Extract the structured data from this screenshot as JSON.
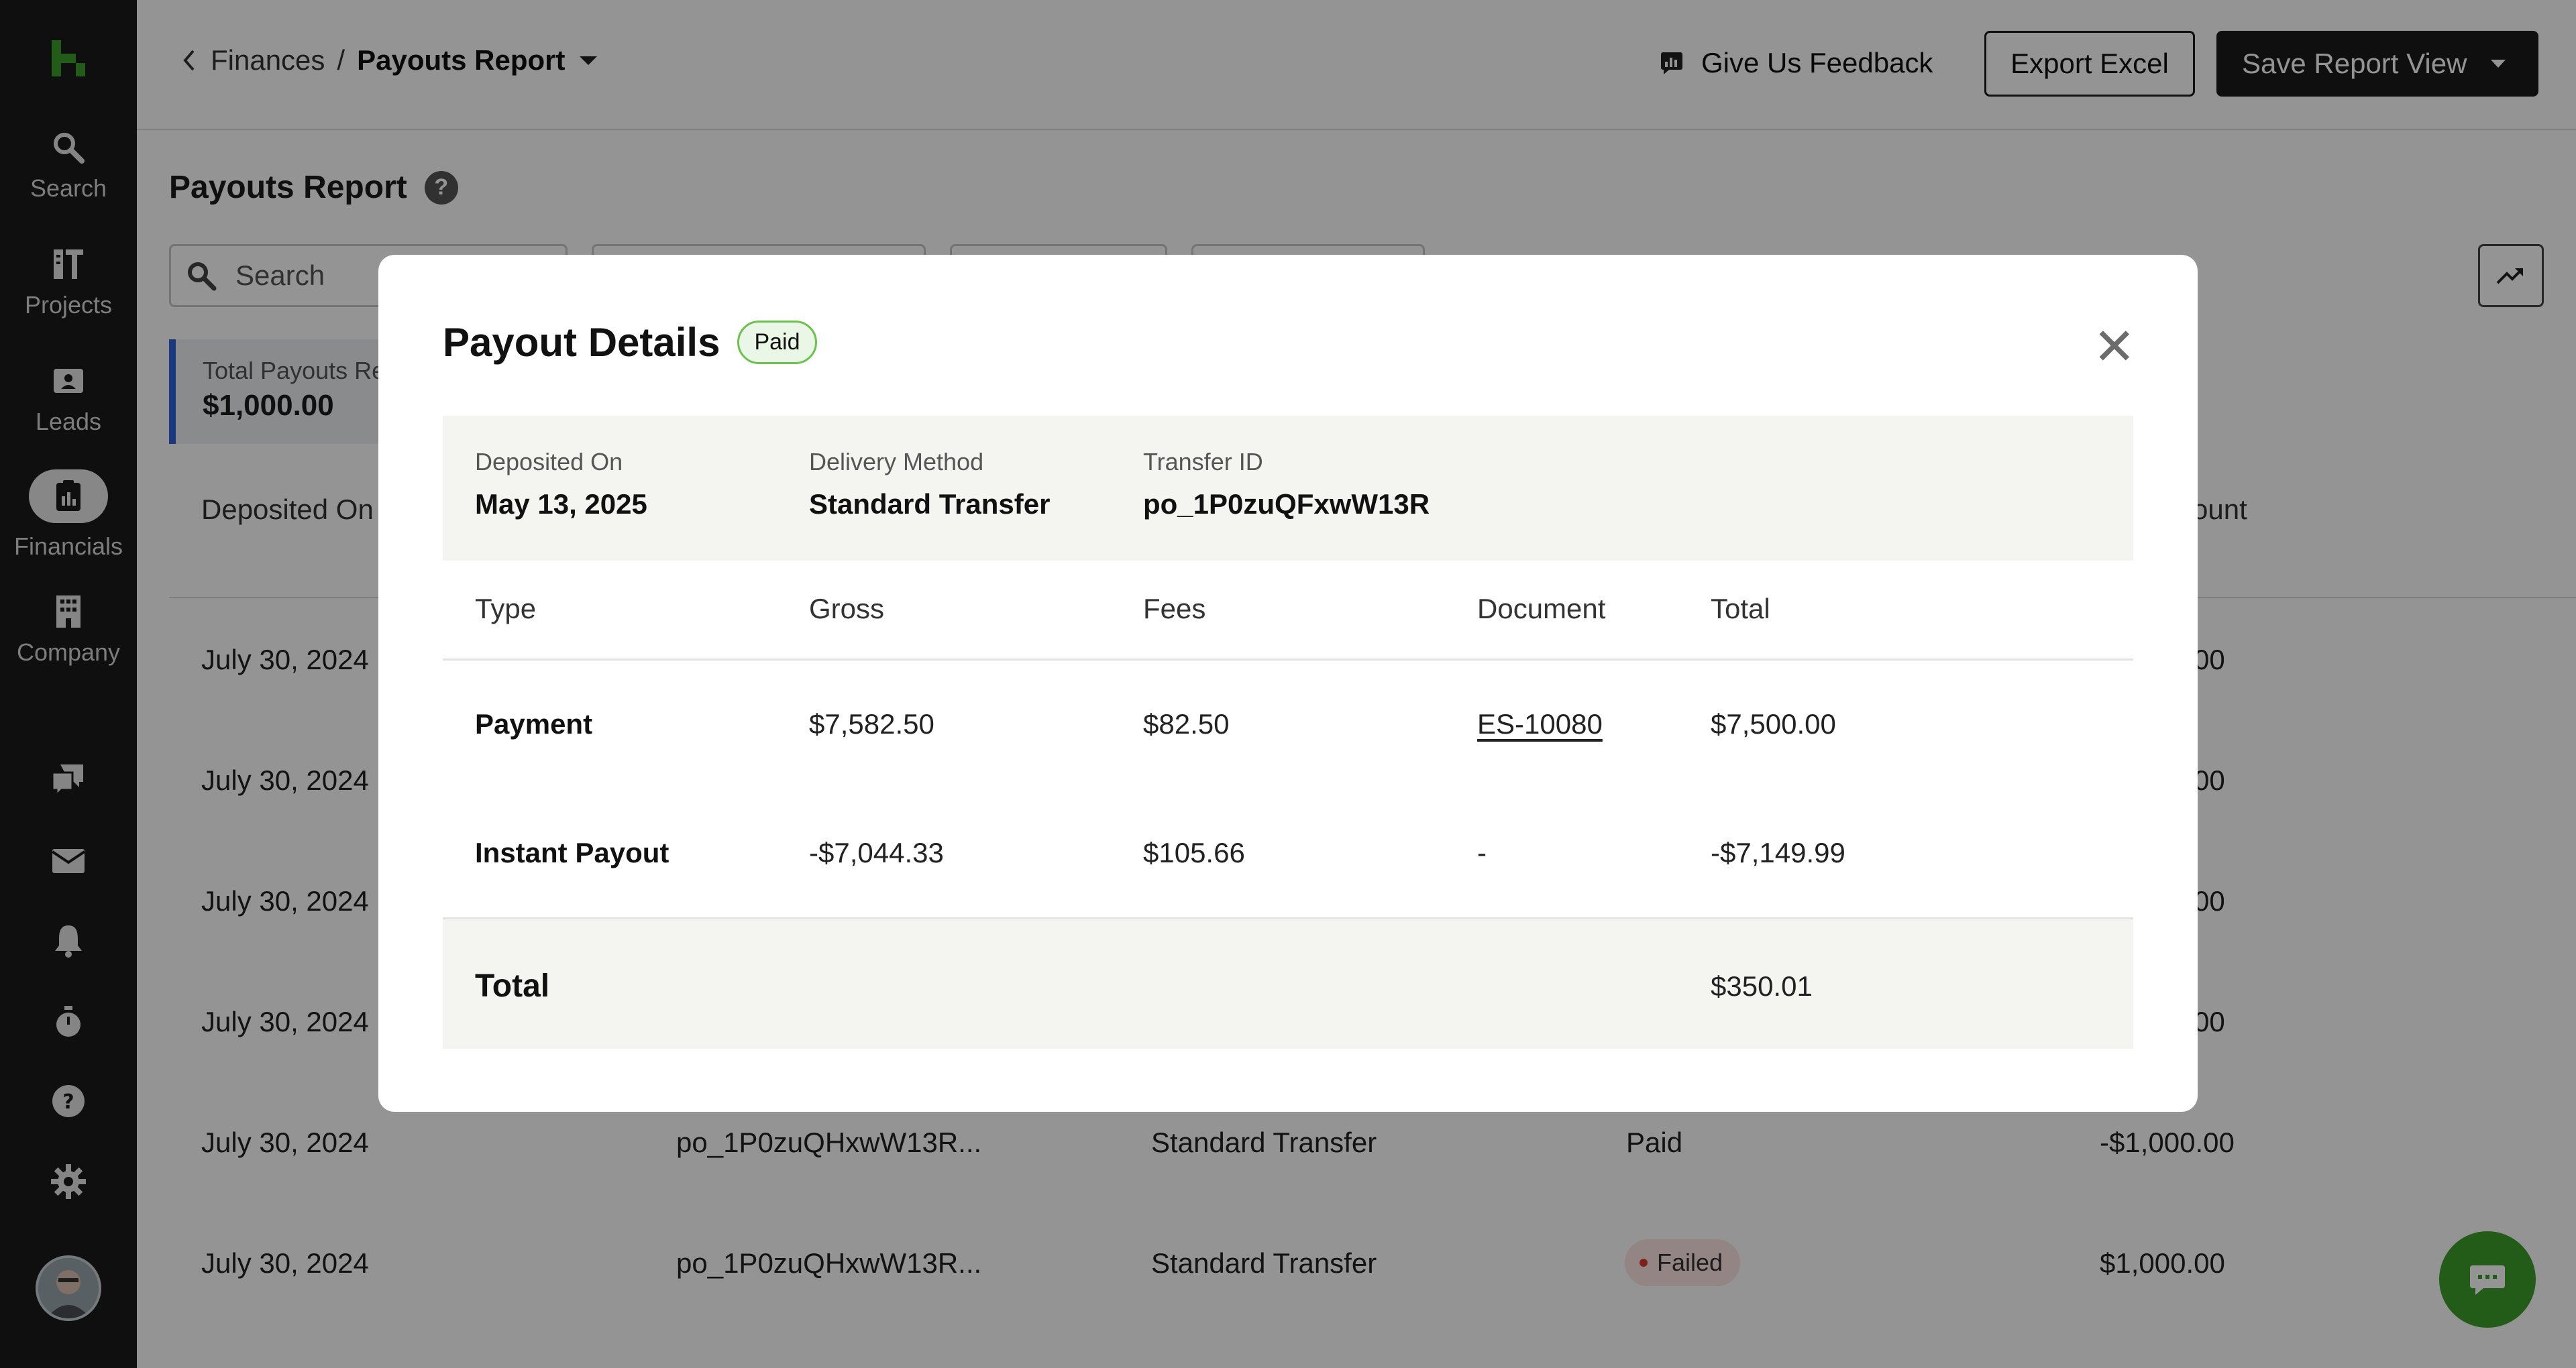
{
  "sidebar": {
    "items": [
      {
        "label": "Search",
        "icon": "search-icon"
      },
      {
        "label": "Projects",
        "icon": "projects-icon"
      },
      {
        "label": "Leads",
        "icon": "leads-icon"
      },
      {
        "label": "Financials",
        "icon": "financials-icon",
        "active": true
      },
      {
        "label": "Company",
        "icon": "company-icon"
      }
    ],
    "secondary_icons": [
      "chat-icon",
      "inbox-icon",
      "bell-icon",
      "timer-icon",
      "help-icon",
      "gear-icon"
    ]
  },
  "header": {
    "breadcrumb_parent": "Finances",
    "breadcrumb_separator": "/",
    "breadcrumb_current": "Payouts Report",
    "feedback_label": "Give Us Feedback",
    "export_label": "Export Excel",
    "save_label": "Save Report View"
  },
  "page": {
    "title": "Payouts Report",
    "help": "?",
    "search_placeholder": "Search",
    "summary_label": "Total Payouts Re",
    "summary_value": "$1,000.00",
    "columns": [
      "Deposited On",
      "ount"
    ],
    "rows": [
      {
        "date": "July 30, 2024",
        "amount_frag": "00"
      },
      {
        "date": "July 30, 2024",
        "amount_frag": "00"
      },
      {
        "date": "July 30, 2024",
        "amount_frag": "00"
      },
      {
        "date": "July 30, 2024",
        "amount_frag": "00"
      },
      {
        "date": "July 30, 2024",
        "transfer": "po_1P0zuQHxwW13R...",
        "method": "Standard Transfer",
        "status": "Paid",
        "amount": "-$1,000.00"
      },
      {
        "date": "July 30, 2024",
        "transfer": "po_1P0zuQHxwW13R...",
        "method": "Standard Transfer",
        "status": "Failed",
        "amount": "$1,000.00"
      }
    ]
  },
  "modal": {
    "title": "Payout Details",
    "status": "Paid",
    "close": "✕",
    "meta": {
      "deposited_label": "Deposited On",
      "deposited_value": "May 13, 2025",
      "method_label": "Delivery Method",
      "method_value": "Standard Transfer",
      "transfer_label": "Transfer ID",
      "transfer_value": "po_1P0zuQFxwW13R"
    },
    "columns": [
      "Type",
      "Gross",
      "Fees",
      "Document",
      "Total"
    ],
    "rows": [
      {
        "type": "Payment",
        "gross": "$7,582.50",
        "fees": "$82.50",
        "document": "ES-10080",
        "total": "$7,500.00"
      },
      {
        "type": "Instant Payout",
        "gross": "-$7,044.33",
        "fees": "$105.66",
        "document": "-",
        "total": "-$7,149.99"
      }
    ],
    "total_label": "Total",
    "total_value": "$350.01"
  },
  "colors": {
    "sidebar_bg": "#1a1a1a",
    "brand_green": "#3d9d2a",
    "paid_border": "#6cc14f",
    "failed_dot": "#d93b2b",
    "summary_accent": "#2f5fd8"
  }
}
